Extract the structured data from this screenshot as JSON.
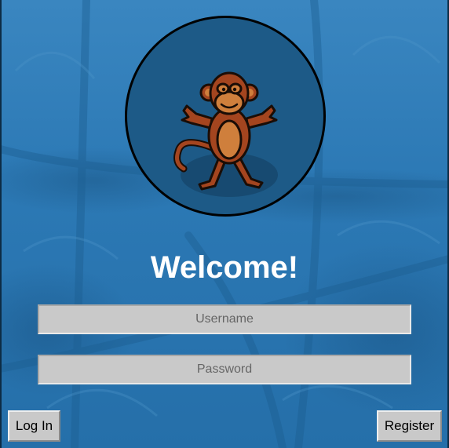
{
  "colors": {
    "background": "#2a78b4",
    "avatar_fill": "#1d5a87",
    "monkey_brown": "#a4451f",
    "monkey_face": "#cf7f3c",
    "input_fill": "#c9c9c9",
    "title_text": "#ffffff"
  },
  "avatar": {
    "icon": "monkey-icon"
  },
  "heading": {
    "text": "Welcome!"
  },
  "form": {
    "username": {
      "placeholder": "Username",
      "value": ""
    },
    "password": {
      "placeholder": "Password",
      "value": ""
    }
  },
  "actions": {
    "login_label": "Log In",
    "register_label": "Register"
  }
}
